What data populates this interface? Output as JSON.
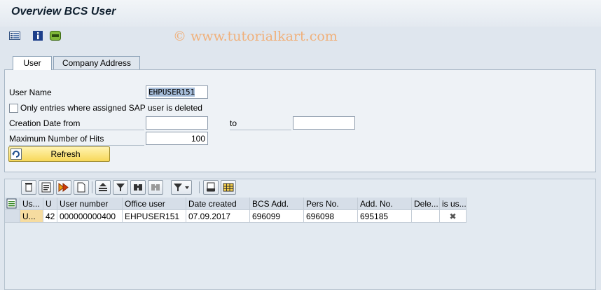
{
  "window": {
    "title": "Overview BCS User"
  },
  "appbar": {
    "icons": [
      "list-icon",
      "info-icon",
      "job-icon"
    ],
    "watermark": "© www.tutorialkart.com"
  },
  "tabs": [
    {
      "label": "User",
      "active": true
    },
    {
      "label": "Company Address",
      "active": false
    }
  ],
  "form": {
    "user_name_label": "User Name",
    "user_name_value": "EHPUSER151",
    "checkbox_label": "Only entries where assigned SAP user is deleted",
    "checkbox_checked": false,
    "creation_date_label": "Creation Date from",
    "creation_date_from": "",
    "to_label": "to",
    "creation_date_to": "",
    "max_hits_label": "Maximum Number of Hits",
    "max_hits_value": "100",
    "refresh_label": "Refresh"
  },
  "grid_toolbar": {
    "buttons": [
      "delete-icon",
      "details-icon",
      "execute-icon",
      "new-document-icon",
      "sort-ascending-icon",
      "filter-icon",
      "find-icon",
      "find-next-icon",
      "set-filter-dropdown-icon",
      "print-preview-icon",
      "spreadsheet-icon"
    ]
  },
  "table": {
    "columns": [
      "Us...",
      "U",
      "User number",
      "Office user",
      "Date created",
      "BCS Add.",
      "Pers No.",
      "Add. No.",
      "Dele...",
      "is us..."
    ],
    "rows": [
      [
        "U...",
        "42",
        "000000000400",
        "EHPUSER151",
        "07.09.2017",
        "696099",
        "696098",
        "695185",
        "",
        "✖"
      ]
    ]
  },
  "colors": {
    "accent_yellow": "#f7d85a",
    "panel_bg": "#eef2f6",
    "highlight_cell": "#f6dca0"
  }
}
